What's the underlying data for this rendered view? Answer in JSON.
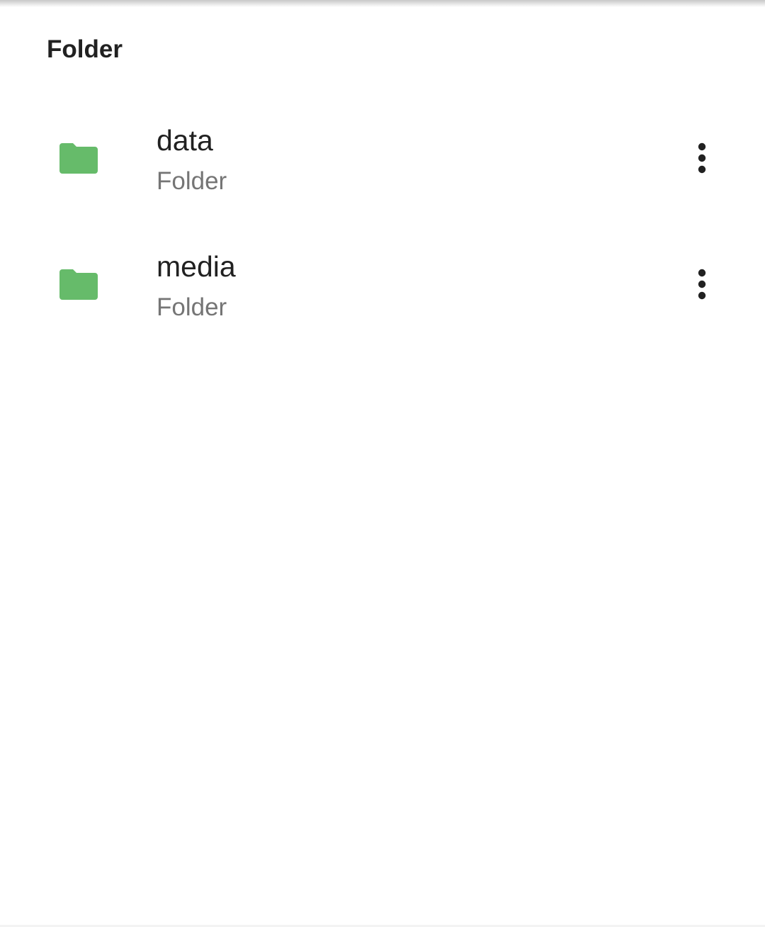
{
  "colors": {
    "folder_icon": "#66BB6A",
    "primary_text": "#212121",
    "secondary_text": "#757575",
    "background": "#FFFFFF"
  },
  "section": {
    "title": "Folder"
  },
  "items": [
    {
      "name": "data",
      "type": "Folder",
      "icon": "folder-icon",
      "menu_icon": "more-vert-icon"
    },
    {
      "name": "media",
      "type": "Folder",
      "icon": "folder-icon",
      "menu_icon": "more-vert-icon"
    }
  ]
}
